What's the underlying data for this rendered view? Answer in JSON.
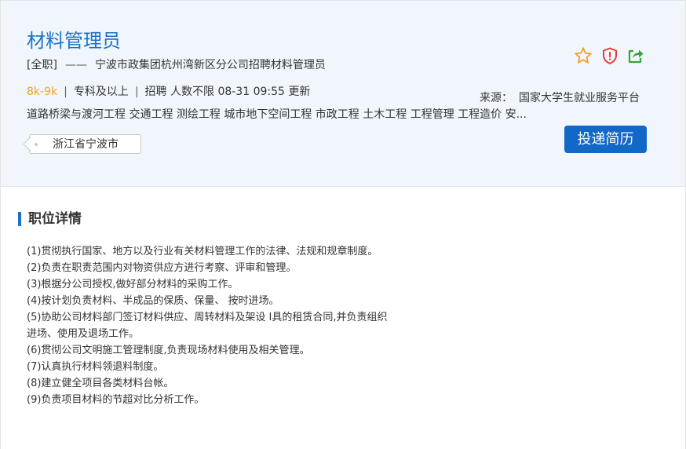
{
  "job": {
    "title": "材料管理员",
    "type_tag": "[全职]",
    "dash": "——",
    "company": "宁波市政集团杭州湾新区分公司招聘材料管理员",
    "salary": "8k-9k",
    "sep": "|",
    "education": "专科及以上",
    "headcount": "招聘 人数不限",
    "updated": "08-31 09:55 更新",
    "majors": "道路桥梁与渡河工程 交通工程 测绘工程 城市地下空间工程 市政工程 土木工程 工程管理 工程造价 安...",
    "location": "浙江省宁波市",
    "source_label": "来源：",
    "source_value": "国家大学生就业服务平台",
    "apply_label": "投递简历"
  },
  "icons": {
    "favorite": "star-outline-icon",
    "report": "shield-alert-icon",
    "share": "share-icon"
  },
  "colors": {
    "title": "#1a73c9",
    "salary": "#f5a023",
    "apply_button": "#1168c6",
    "header_bg": "#f0f6fb",
    "star": "#f5a023",
    "shield": "#e53935",
    "share": "#3aa33a"
  },
  "details": {
    "section_title": "职位详情",
    "items": [
      "(1)贯彻执行国家、地方以及行业有关材料管理工作的法律、法规和规章制度。",
      "(2)负责在职责范围内对物资供应方进行考察、评审和管理。",
      "(3)根据分公司授权,做好部分材料的采购工作。",
      "(4)按计划负责材料、半成品的保质、保量、 按时进场。",
      "(5)协助公司材料部门签订材料供应、周转材料及架设 I具的租赁合同,并负责组织",
      "进场、使用及退场工作。",
      "(6)贯彻公司文明施工管理制度,负责现场材料使用及相关管理。",
      "(7)认真执行材料领退料制度。",
      "(8)建立健全项目各类材料台帐。",
      "(9)负责项目材料的节超对比分析工作。"
    ]
  }
}
